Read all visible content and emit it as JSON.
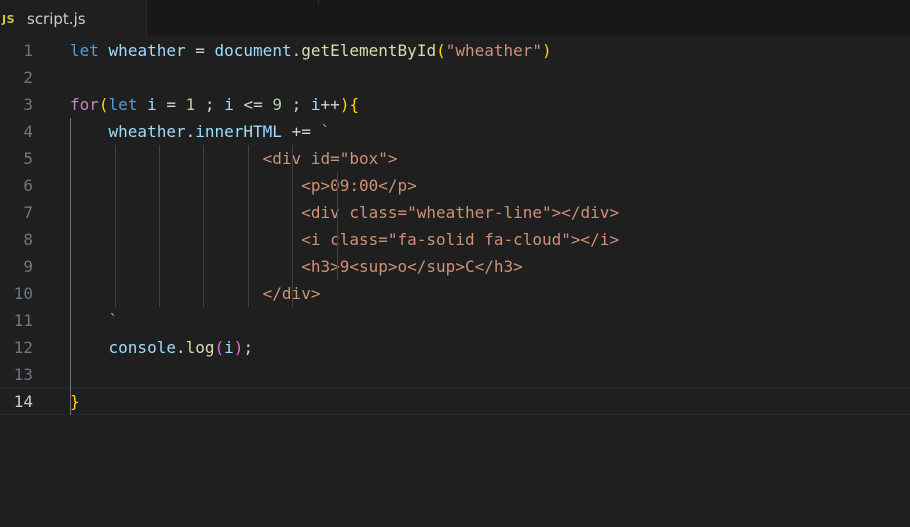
{
  "tab": {
    "icon": "JS",
    "filename": "script.js",
    "icon_color": "#cbcb41"
  },
  "editor": {
    "active_line": 14,
    "lines": [
      {
        "n": "1",
        "tokens": [
          [
            "kw",
            "let"
          ],
          [
            "op",
            " "
          ],
          [
            "var",
            "wheather"
          ],
          [
            "op",
            " = "
          ],
          [
            "var",
            "document"
          ],
          [
            "op",
            "."
          ],
          [
            "fn",
            "getElementById"
          ],
          [
            "b1",
            "("
          ],
          [
            "str",
            "\"wheather\""
          ],
          [
            "b1",
            ")"
          ]
        ]
      },
      {
        "n": "2",
        "tokens": []
      },
      {
        "n": "3",
        "tokens": [
          [
            "ctl",
            "for"
          ],
          [
            "b1",
            "("
          ],
          [
            "kw",
            "let"
          ],
          [
            "op",
            " "
          ],
          [
            "var",
            "i"
          ],
          [
            "op",
            " = "
          ],
          [
            "num",
            "1"
          ],
          [
            "op",
            " ; "
          ],
          [
            "var",
            "i"
          ],
          [
            "op",
            " <= "
          ],
          [
            "num",
            "9"
          ],
          [
            "op",
            " ; "
          ],
          [
            "var",
            "i"
          ],
          [
            "op",
            "++"
          ],
          [
            "b1",
            ")"
          ],
          [
            "b1",
            "{"
          ]
        ]
      },
      {
        "n": "4",
        "tokens": [
          [
            "op",
            "    "
          ],
          [
            "var",
            "wheather"
          ],
          [
            "op",
            "."
          ],
          [
            "var",
            "innerHTML"
          ],
          [
            "op",
            " += "
          ],
          [
            "str",
            "`"
          ]
        ]
      },
      {
        "n": "5",
        "tokens": [
          [
            "str",
            "                    <div id=\"box\">"
          ]
        ]
      },
      {
        "n": "6",
        "tokens": [
          [
            "str",
            "                        <p>09:00</p>"
          ]
        ]
      },
      {
        "n": "7",
        "tokens": [
          [
            "str",
            "                        <div class=\"wheather-line\"></div>"
          ]
        ]
      },
      {
        "n": "8",
        "tokens": [
          [
            "str",
            "                        <i class=\"fa-solid fa-cloud\"></i>"
          ]
        ]
      },
      {
        "n": "9",
        "tokens": [
          [
            "str",
            "                        <h3>9<sup>o</sup>C</h3>"
          ]
        ]
      },
      {
        "n": "10",
        "tokens": [
          [
            "str",
            "                    </div>"
          ]
        ]
      },
      {
        "n": "11",
        "tokens": [
          [
            "str",
            "    `"
          ]
        ]
      },
      {
        "n": "12",
        "tokens": [
          [
            "op",
            "    "
          ],
          [
            "var",
            "console"
          ],
          [
            "op",
            "."
          ],
          [
            "fn",
            "log"
          ],
          [
            "b2",
            "("
          ],
          [
            "var",
            "i"
          ],
          [
            "b2",
            ")"
          ],
          [
            "op",
            ";"
          ]
        ]
      },
      {
        "n": "13",
        "tokens": []
      },
      {
        "n": "14",
        "tokens": [
          [
            "b1",
            "}"
          ]
        ]
      }
    ]
  }
}
